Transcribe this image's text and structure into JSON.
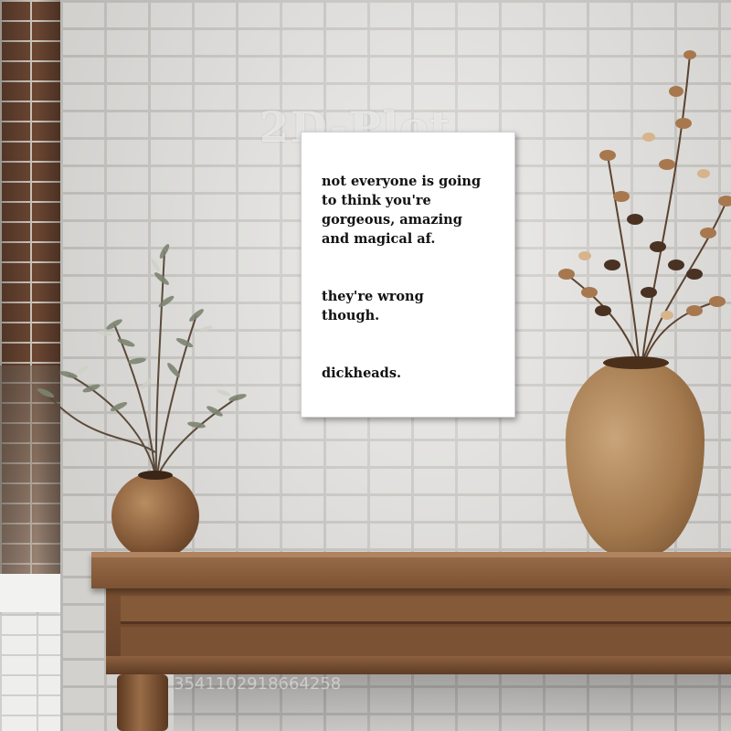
{
  "poster": {
    "paragraphs": [
      "not everyone is going\nto think you're\ngorgeous, amazing\nand magical af.",
      "they're wrong\nthough.",
      "dickheads."
    ]
  },
  "watermark": {
    "text": "2D-Plot",
    "code": "3541102918664258"
  },
  "colors": {
    "wall": "#e4e3e0",
    "brick": "#6b4632",
    "wood": "#7b5233",
    "poster_bg": "#ffffff",
    "poster_text": "#111111"
  }
}
